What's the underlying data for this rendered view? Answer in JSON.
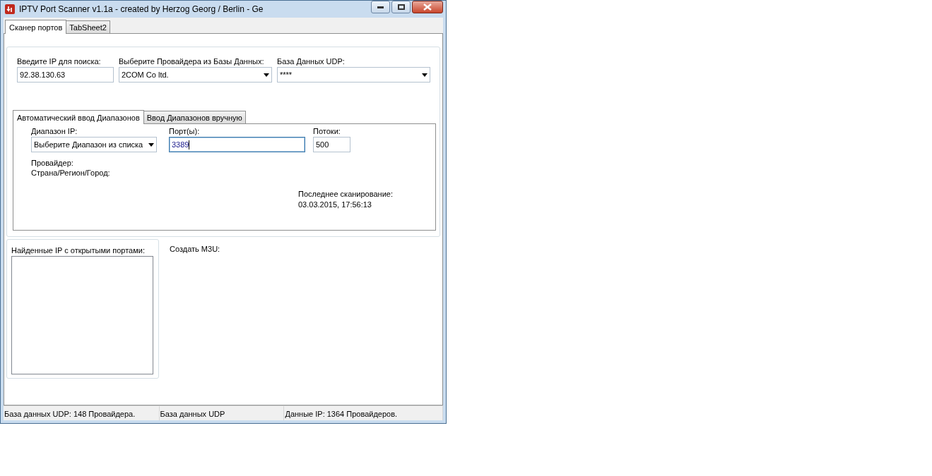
{
  "window": {
    "title": "IPTV Port Scanner v1.1a - created by Herzog Georg / Berlin - Ge"
  },
  "tabs": [
    {
      "label": "Сканер портов",
      "selected": true
    },
    {
      "label": "TabSheet2",
      "selected": false
    }
  ],
  "search_fields": [
    {
      "kind": "input",
      "label": "Введите IP для поиска:",
      "value": "92.38.130.63"
    },
    {
      "kind": "dropdown",
      "label": "Выберите Провайдера из Базы Данных:",
      "value": "2COM Co ltd."
    },
    {
      "kind": "dropdown",
      "label": "База Данных UDP:",
      "value": "****"
    }
  ],
  "range_tabs": [
    {
      "label": "Автоматический ввод Диапазонов",
      "selected": true
    },
    {
      "label": "Ввод Диапазонов вручную",
      "selected": false
    }
  ],
  "range_fields": [
    {
      "kind": "dropdown",
      "label": "Диапазон IP:",
      "value": "Выберите Диапазон из списка",
      "focused": false
    },
    {
      "kind": "input",
      "label": "Порт(ы):",
      "value": "3389",
      "focused": true
    },
    {
      "kind": "input",
      "label": "Потоки:",
      "value": "500",
      "focused": false
    }
  ],
  "info": {
    "provider_label": "Провайдер:",
    "location_label": "Страна/Регион/Город:",
    "last_scan_label": "Последнее сканирование:",
    "last_scan_value": "03.03.2015, 17:56:13"
  },
  "found_ips": {
    "label": "Найденные IP с открытыми портами:"
  },
  "m3u": {
    "label": "Создать M3U:"
  },
  "status_bar": [
    "База данных UDP: 148 Провайдера.",
    "База данных UDP",
    "Данные IP: 1364 Провайдеров."
  ]
}
